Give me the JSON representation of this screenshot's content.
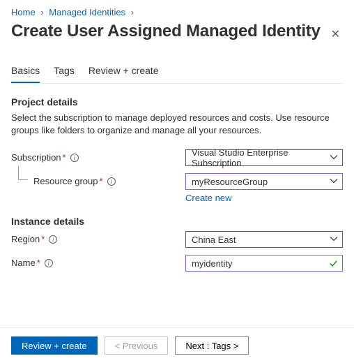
{
  "breadcrumb": {
    "items": [
      "Home",
      "Managed Identities"
    ]
  },
  "title": "Create User Assigned Managed Identity",
  "tabs": [
    {
      "label": "Basics",
      "active": true
    },
    {
      "label": "Tags",
      "active": false
    },
    {
      "label": "Review + create",
      "active": false
    }
  ],
  "project": {
    "heading": "Project details",
    "description": "Select the subscription to manage deployed resources and costs. Use resource groups like folders to organize and manage all your resources.",
    "subscription_label": "Subscription",
    "subscription_value": "Visual Studio Enterprise Subscription",
    "resource_group_label": "Resource group",
    "resource_group_value": "myResourceGroup",
    "create_new_link": "Create new"
  },
  "instance": {
    "heading": "Instance details",
    "region_label": "Region",
    "region_value": "China East",
    "name_label": "Name",
    "name_value": "myidentity"
  },
  "footer": {
    "review_create": "Review + create",
    "previous": "< Previous",
    "next": "Next : Tags >"
  }
}
